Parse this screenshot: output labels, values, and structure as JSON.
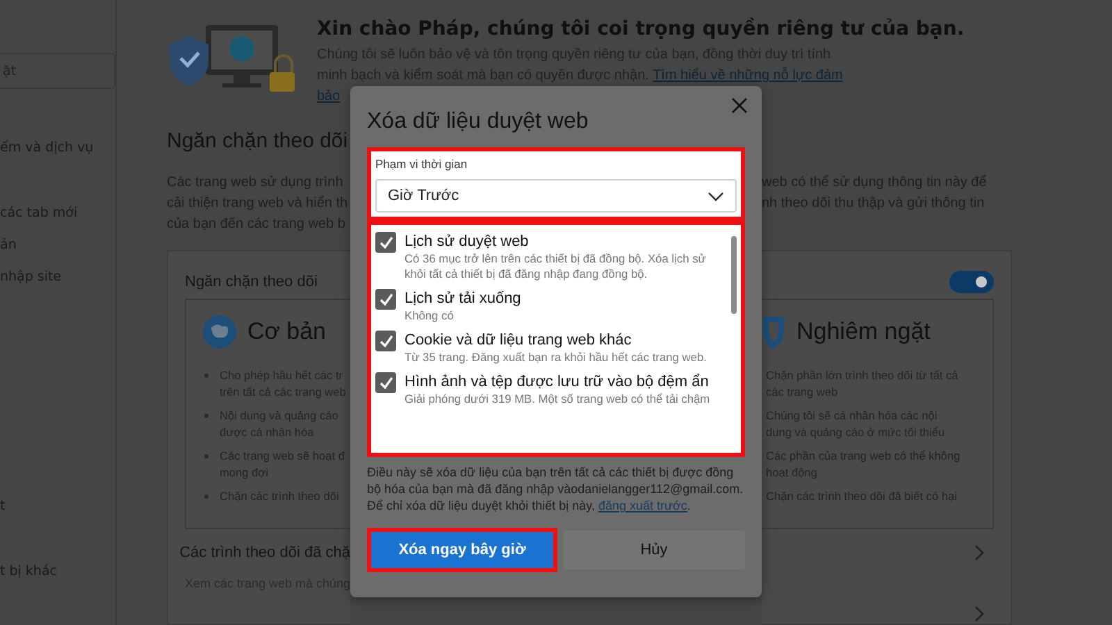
{
  "sidebar": {
    "search": {
      "value": "ặt"
    },
    "items": [
      {
        "label": "ếm và dịch vụ"
      },
      {
        "label": "các tab mới"
      },
      {
        "label": "ản"
      },
      {
        "label": "nhập site"
      },
      {
        "label": "t"
      },
      {
        "label": "t bị khác"
      }
    ]
  },
  "header": {
    "title": "Xin chào Pháp, chúng tôi coi trọng quyền riêng tư của bạn.",
    "lines": [
      "Chúng tôi sẽ luôn bảo vệ và tôn trọng quyền riêng tư của bạn, đồng thời duy trì tính",
      "minh bạch và kiểm soát mà bạn có quyền được nhận."
    ],
    "link_lines": [
      "Tìm hiểu về những nỗ lực đảm",
      "bảo"
    ]
  },
  "section": {
    "title": "Ngăn chặn theo dõi",
    "left_lines": [
      "Các trang web sử dụng trình",
      "cải thiện trang web và hiển th",
      "của bạn đến các trang web b"
    ],
    "right_lines": [
      "web có thể sử dụng thông tin này để",
      "nh theo dõi thu thập và gửi thông tin"
    ]
  },
  "tracking_card": {
    "title": "Ngăn chặn theo dõi",
    "toggle": {
      "on": true
    },
    "levels": [
      {
        "name": "Cơ bản",
        "bullets": [
          [
            "Cho phép hầu hết các tr",
            "trên tất cả các trang web"
          ],
          [
            "Nội dung và quảng cáo",
            "được cá nhân hóa"
          ],
          [
            "Các trang web sẽ hoạt đ",
            "mong đợi"
          ],
          [
            "Chặn các trình theo dõi"
          ]
        ]
      },
      {
        "name": "Nghiêm ngặt",
        "bullets": [
          [
            "Chặn phần lớn trình theo dõi từ tất cả",
            "các trang web"
          ],
          [
            "Chúng tôi sẽ cá nhân hóa các nội",
            "dung và quảng cáo ở mức tối thiểu"
          ],
          [
            "Các phần của trang web có thể không",
            "hoạt động"
          ],
          [
            "Chặn các trình theo dõi đã biết có hại"
          ]
        ]
      }
    ]
  },
  "blocked_trackers": {
    "title": "Các trình theo dõi đã chặ",
    "subtitle": "Xem các trang web mà chúng"
  },
  "dialog": {
    "title": "Xóa dữ liệu duyệt web",
    "time_range": {
      "label": "Phạm vi thời gian",
      "value": "Giờ Trước",
      "highlighted": true
    },
    "data_types": {
      "highlighted": true,
      "items": [
        {
          "title": "Lịch sử duyệt web",
          "description": "Có 36 mục trở lên trên các thiết bị đã đồng bộ. Xóa lịch sử khỏi tất cả thiết bị đã đăng nhập đang đồng bộ.",
          "checked": true
        },
        {
          "title": "Lịch sử tải xuống",
          "description": "Không có",
          "checked": true
        },
        {
          "title": "Cookie và dữ liệu trang web khác",
          "description": "Từ 35 trang. Đăng xuất bạn ra khỏi hầu hết các trang web.",
          "checked": true
        },
        {
          "title": "Hình ảnh và tệp được lưu trữ vào bộ đệm ẩn",
          "description": "Giải phóng dưới 319 MB. Một số trang web có thể tải chậm",
          "checked": true
        }
      ]
    },
    "note": {
      "text": "Điều này sẽ xóa dữ liệu của bạn trên tất cả các thiết bị được đồng bộ hóa của bạn mà đã đăng nhập vàodanielangger112@gmail.com. Để chỉ xóa dữ liệu duyệt khỏi thiết bị này,",
      "link": "đăng xuất trước",
      "after": "."
    },
    "buttons": [
      {
        "label": "Xóa ngay bây giờ",
        "kind": "primary",
        "highlighted": true
      },
      {
        "label": "Hủy",
        "kind": "secondary",
        "highlighted": false
      }
    ]
  }
}
